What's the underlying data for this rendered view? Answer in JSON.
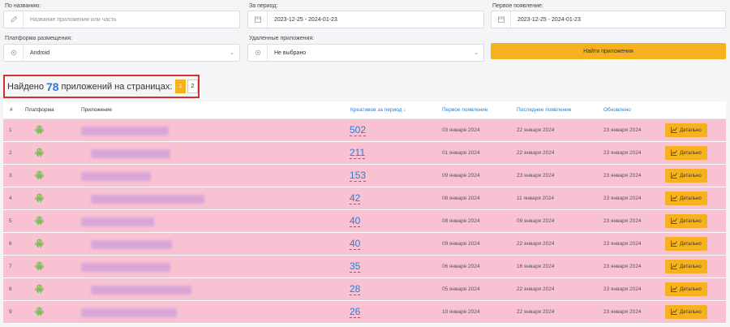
{
  "filters": {
    "name": {
      "label": "По названию:",
      "placeholder": "Название приложения или часть"
    },
    "period": {
      "label": "За период:",
      "value": "2023-12-25 - 2024-01-23"
    },
    "first_seen": {
      "label": "Первое появление:",
      "value": "2023-12-25 - 2024-01-23"
    },
    "platform": {
      "label": "Платформа размещения:",
      "value": "Android"
    },
    "removed": {
      "label": "Удаленные приложения:",
      "value": "Не выбрано"
    },
    "find_button": "Найти приложения"
  },
  "found": {
    "prefix": "Найдено",
    "count": "78",
    "suffix": "приложений на страницах:",
    "pages": [
      "1",
      "2"
    ]
  },
  "table": {
    "headers": {
      "num": "#",
      "platform": "Платформа",
      "app": "Приложение",
      "creatives": "Креативов за период ↓",
      "first": "Первое появление",
      "last": "Последнее появление",
      "updated": "Обновлено"
    },
    "detail_label": "Детально",
    "rows": [
      {
        "idx": "1",
        "creatives": "502",
        "first": "03 января 2024",
        "last": "22 января 2024",
        "updated": "23 января 2024"
      },
      {
        "idx": "2",
        "creatives": "211",
        "first": "01 января 2024",
        "last": "22 января 2024",
        "updated": "23 января 2024"
      },
      {
        "idx": "3",
        "creatives": "153",
        "first": "09 января 2024",
        "last": "23 января 2024",
        "updated": "23 января 2024"
      },
      {
        "idx": "4",
        "creatives": "42",
        "first": "08 января 2024",
        "last": "11 января 2024",
        "updated": "23 января 2024"
      },
      {
        "idx": "5",
        "creatives": "40",
        "first": "08 января 2024",
        "last": "09 января 2024",
        "updated": "23 января 2024"
      },
      {
        "idx": "6",
        "creatives": "40",
        "first": "09 января 2024",
        "last": "22 января 2024",
        "updated": "23 января 2024"
      },
      {
        "idx": "7",
        "creatives": "35",
        "first": "06 января 2024",
        "last": "16 января 2024",
        "updated": "23 января 2024"
      },
      {
        "idx": "8",
        "creatives": "28",
        "first": "05 января 2024",
        "last": "22 января 2024",
        "updated": "23 января 2024"
      },
      {
        "idx": "9",
        "creatives": "26",
        "first": "10 января 2024",
        "last": "22 января 2024",
        "updated": "23 января 2024"
      }
    ]
  },
  "colors": {
    "accent": "#f5b21e",
    "link": "#2e7bd6",
    "row_bg": "#f9c2d3",
    "highlight_border": "#d32f2f",
    "android": "#78c257"
  }
}
